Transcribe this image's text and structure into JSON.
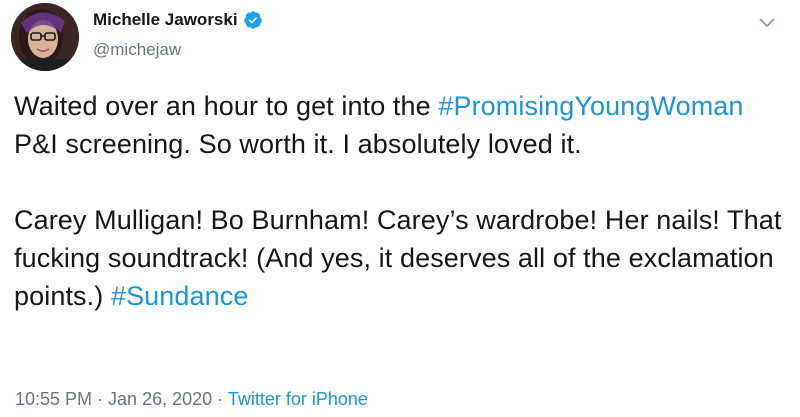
{
  "user": {
    "display_name": "Michelle Jaworski",
    "handle": "@michejaw",
    "verified": true
  },
  "icons": {
    "verified": "verified-badge-icon",
    "caret": "chevron-down-icon"
  },
  "tweet": {
    "p1_t1": "Waited over an hour to get into the ",
    "p1_h1": "#PromisingYoungWoman",
    "p1_t2": " P&I screening. So worth it. I absolutely loved it.",
    "p2_t1": "Carey Mulligan! Bo Burnham! Carey’s wardrobe! Her nails! That fucking soundtrack! (And yes, it deserves all of the exclamation points.) ",
    "p2_h1": "#Sundance"
  },
  "meta": {
    "time": "10:55 PM",
    "sep1": " · ",
    "date": "Jan 26, 2020",
    "sep2": " · ",
    "source": "Twitter for iPhone"
  },
  "colors": {
    "link": "#1b95e0",
    "secondary": "#657786",
    "text": "#14171a",
    "verified": "#1da1f2"
  }
}
